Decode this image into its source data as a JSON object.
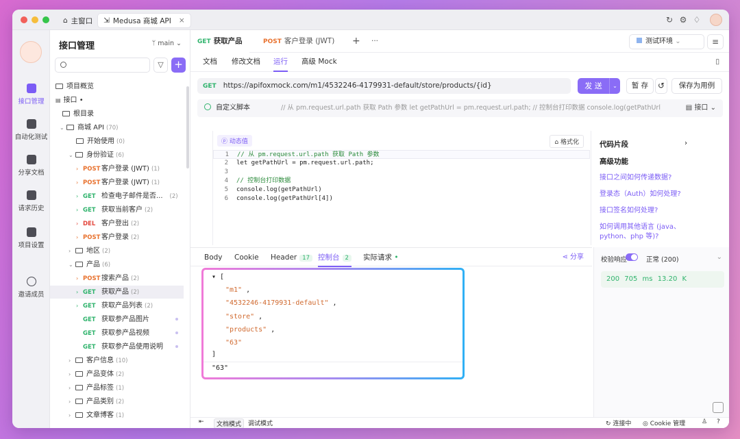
{
  "window": {
    "tabs": [
      {
        "label": "主窗口"
      },
      {
        "label": "Medusa 商城 API"
      }
    ],
    "colors": {
      "accent": "#7b5cf5",
      "get": "#2fb36c",
      "post": "#e8722f",
      "del": "#e3463c"
    }
  },
  "rail": {
    "items": [
      {
        "label": "接口管理",
        "icon": "api-icon"
      },
      {
        "label": "自动化测试",
        "icon": "automation-icon"
      },
      {
        "label": "分享文档",
        "icon": "share-doc-icon"
      },
      {
        "label": "请求历史",
        "icon": "history-icon"
      },
      {
        "label": "项目设置",
        "icon": "settings-icon"
      },
      {
        "label": "邀请成员",
        "icon": "invite-icon"
      }
    ]
  },
  "sidebar": {
    "title": "接口管理",
    "branch": "main",
    "tree": [
      {
        "label": "项目概览"
      },
      {
        "label": "接口"
      },
      {
        "label": "根目录"
      },
      {
        "label": "商城 API",
        "count": "(70)"
      },
      {
        "label": "开始使用",
        "count": "(0)"
      },
      {
        "label": "身份验证",
        "count": "(6)"
      },
      {
        "method": "POST",
        "label": "客户登录 (JWT)",
        "count": "(1)"
      },
      {
        "method": "POST",
        "label": "客户登录 (JWT)",
        "count": "(1)"
      },
      {
        "method": "GET",
        "label": "检查电子邮件是否...",
        "count": "(2)"
      },
      {
        "method": "GET",
        "label": "获取当前客户",
        "count": "(2)"
      },
      {
        "method": "DEL",
        "label": "客户登出",
        "count": "(2)"
      },
      {
        "method": "POST",
        "label": "客户登录",
        "count": "(2)"
      },
      {
        "label": "地区",
        "count": "(2)"
      },
      {
        "label": "产品",
        "count": "(6)"
      },
      {
        "method": "POST",
        "label": "搜索产品",
        "count": "(2)"
      },
      {
        "method": "GET",
        "label": "获取产品",
        "count": "(2)"
      },
      {
        "method": "GET",
        "label": "获取产品列表",
        "count": "(2)"
      },
      {
        "method": "GET",
        "label": "获取参产品图片",
        "count": ""
      },
      {
        "method": "GET",
        "label": "获取参产品视频",
        "count": ""
      },
      {
        "method": "GET",
        "label": "获取参产品使用说明",
        "count": ""
      },
      {
        "label": "客户信息",
        "count": "(10)"
      },
      {
        "label": "产品变体",
        "count": "(2)"
      },
      {
        "label": "产品标签",
        "count": "(1)"
      },
      {
        "label": "产品类别",
        "count": "(2)"
      },
      {
        "label": "文章博客",
        "count": "(1)"
      }
    ]
  },
  "main": {
    "tabs": [
      {
        "method": "GET",
        "label": "获取产品"
      },
      {
        "method": "POST",
        "label": "客户登录 (JWT)"
      }
    ],
    "env": "测试环境",
    "subtabs": [
      "文档",
      "修改文档",
      "运行",
      "高级 Mock"
    ],
    "url_method": "GET",
    "url": "https://apifoxmock.com/m1/4532246-4179931-default/store/products/{id}",
    "send": "发 送",
    "save": "暂 存",
    "save_case": "保存为用例",
    "script_title": "自定义脚本",
    "script_comment": "// 从 pm.request.url.path 获取 Path 参数 let getPathUrl = pm.request.url.path; // 控制台打印数据 console.log(getPathUrl) cons...",
    "script_scope": "接口",
    "dynamic": "动态值",
    "format": "格式化",
    "code": [
      {
        "n": "1",
        "text": "// 从 pm.request.url.path 获取 Path 参数"
      },
      {
        "n": "2",
        "text": "let getPathUrl = pm.request.url.path;"
      },
      {
        "n": "3",
        "text": ""
      },
      {
        "n": "4",
        "text": "// 控制台打印数据"
      },
      {
        "n": "5",
        "text": "console.log(getPathUrl)"
      },
      {
        "n": "6",
        "text": "console.log(getPathUrl[4])"
      }
    ],
    "snippets": {
      "title": "代码片段",
      "advanced": "高级功能",
      "links": [
        "接口之间如何传递数据?",
        "登录态（Auth）如何处理?",
        "接口签名如何处理?",
        "如何调用其他语言 (java、python、php 等)?"
      ]
    },
    "resp_tabs": {
      "body": "Body",
      "cookie": "Cookie",
      "header": "Header",
      "header_count": "17",
      "console": "控制台",
      "console_count": "2",
      "actual": "实际请求",
      "share": "分享"
    },
    "console_out": [
      "\"m1\"",
      "\"4532246-4179931-default\"",
      "\"store\"",
      "\"products\"",
      "\"63\""
    ],
    "console_last": "\"63\"",
    "validate": "校验响应",
    "normal": "正常 (200)",
    "status": "200",
    "time": "705 ms",
    "size": "13.20 K"
  },
  "footer": {
    "doc_mode": "文档模式",
    "debug_mode": "调试模式",
    "connecting": "连接中",
    "cookie": "Cookie 管理"
  }
}
